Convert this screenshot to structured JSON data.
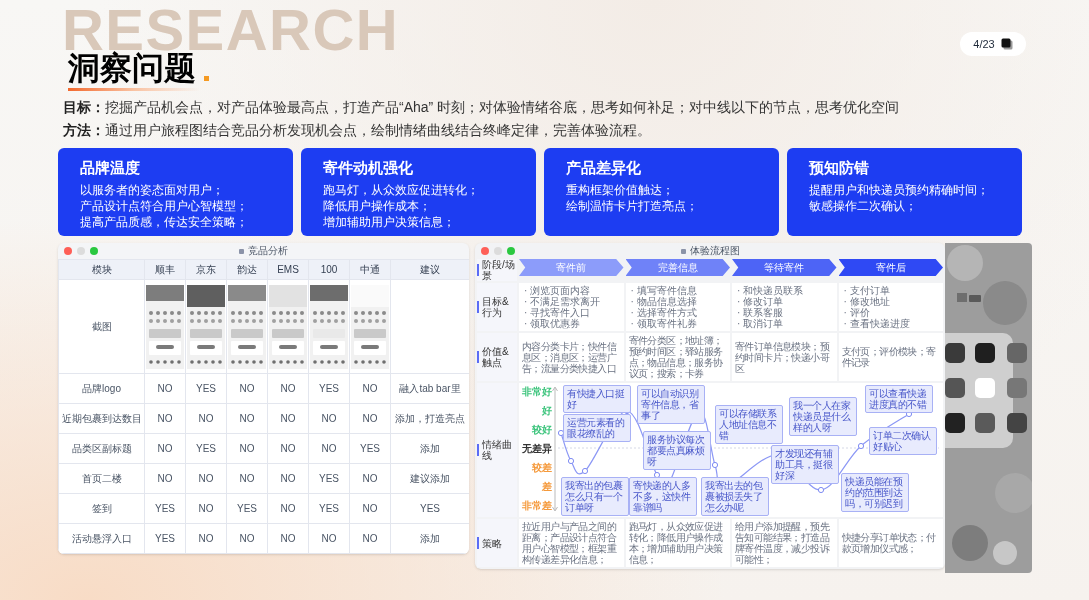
{
  "background_word": "RESEARCH",
  "title": "洞察问题",
  "page": "4/23",
  "intro": [
    {
      "label": "目标：",
      "text": "挖掘产品机会点，对产品体验最高点，打造产品“Aha” 时刻；对体验情绪谷底，思考如何补足；对中线以下的节点，思考优化空间"
    },
    {
      "label": "方法：",
      "text": "通过用户旅程图结合竞品分析发现机会点，绘制情绪曲线结合终峰定律，完善体验流程。"
    }
  ],
  "cards": [
    {
      "title": "品牌温度",
      "lines": [
        "以服务者的姿态面对用户；",
        "产品设计点符合用户心智模型；",
        "提高产品质感，传达安全策略；"
      ]
    },
    {
      "title": "寄件动机强化",
      "lines": [
        "跑马灯，从众效应促进转化；",
        "降低用户操作成本；",
        "增加辅助用户决策信息；"
      ]
    },
    {
      "title": "产品差异化",
      "lines": [
        "重构框架价值触达；",
        "绘制温情卡片打造亮点；"
      ]
    },
    {
      "title": "预知防错",
      "lines": [
        "提醒用户和快递员预约精确时间；",
        "敏感操作二次确认；"
      ]
    }
  ],
  "comparison_window": {
    "title": "竞品分析",
    "columns": [
      "模块",
      "顺丰",
      "京东",
      "韵达",
      "EMS",
      "100",
      "中通",
      "建议"
    ],
    "screenshot_row_label": "截图",
    "rows": [
      [
        "品牌logo",
        "NO",
        "YES",
        "NO",
        "NO",
        "YES",
        "NO",
        "融入tab bar里"
      ],
      [
        "近期包裹到达数目",
        "NO",
        "NO",
        "NO",
        "NO",
        "NO",
        "NO",
        "添加，打造亮点"
      ],
      [
        "品类区副标题",
        "NO",
        "YES",
        "NO",
        "NO",
        "NO",
        "YES",
        "添加"
      ],
      [
        "首页二楼",
        "NO",
        "NO",
        "NO",
        "NO",
        "YES",
        "NO",
        "建议添加"
      ],
      [
        "签到",
        "YES",
        "NO",
        "YES",
        "NO",
        "YES",
        "NO",
        "YES"
      ],
      [
        "活动悬浮入口",
        "YES",
        "NO",
        "NO",
        "NO",
        "NO",
        "NO",
        "添加"
      ]
    ]
  },
  "journey_window": {
    "title": "体验流程图",
    "row_labels": {
      "stage": "阶段/场景",
      "goals": "目标&行为",
      "touchpoints": "价值&触点",
      "curve": "情绪曲线",
      "strategy": "策略"
    },
    "stages": [
      {
        "name": "寄件前",
        "color": "#8c9cfa",
        "goals": [
          "· 浏览页面内容",
          "· 不满足需求离开",
          "· 寻找寄件入口",
          "· 领取优惠券"
        ],
        "touchpoints": "内容分类卡片；快件信息区；消息区；运营广告；流量分类快捷入口",
        "strategy": "拉近用户与产品之间的距离；产品设计点符合用户心智模型；框架重构传递差异化信息；"
      },
      {
        "name": "完善信息",
        "color": "#6f82f8",
        "goals": [
          "· 填写寄件信息",
          "· 物品信息选择",
          "· 选择寄件方式",
          "· 领取寄件礼券"
        ],
        "touchpoints": "寄件分类区；地址簿；预约时间区；驿站服务点；物品信息；服务协议页；搜索；卡券",
        "strategy": "跑马灯，从众效应促进转化；降低用户操作成本；增加辅助用户决策信息；"
      },
      {
        "name": "等待寄件",
        "color": "#4d64f6",
        "goals": [
          "· 和快递员联系",
          "· 修改订单",
          "· 联系客服",
          "· 取消订单"
        ],
        "touchpoints": "寄件订单信息模块；预约时间卡片；快递小哥区",
        "strategy": "给用户添加提醒，预先告知可能结果；打造品牌寄件温度，减少投诉可能性；"
      },
      {
        "name": "寄件后",
        "color": "#2f49f4",
        "goals": [
          "· 支付订单",
          "· 修改地址",
          "· 评价",
          "· 查看快递进度"
        ],
        "touchpoints": "支付页；评价模块；寄件记录",
        "strategy": "快捷分享订单状态；付款页增加仪式感；"
      }
    ],
    "levels": [
      {
        "label": "非常好",
        "color": "#3cc47c"
      },
      {
        "label": "好",
        "color": "#3cc47c"
      },
      {
        "label": "较好",
        "color": "#3cc47c"
      },
      {
        "label": "无差异",
        "color": "#333333"
      },
      {
        "label": "较差",
        "color": "#f59a3c"
      },
      {
        "label": "差",
        "color": "#f59a3c"
      },
      {
        "label": "非常差",
        "color": "#f59a3c"
      }
    ],
    "notes": [
      "有快捷入口挺好",
      "运营元素看的眼花缭乱的",
      "我寄出的包裹怎么只有一个订单呀",
      "可以自动识别寄件信息，省事了",
      "服务协议每次都要点真麻烦呀",
      "寄快递的人多不多，这快件靠谱吗",
      "可以存储联系人地址信息不错",
      "我寄出去的包裹被损丢失了怎么办呢",
      "我一个人在家快递员是什么样的人呀",
      "才发现还有辅助工具，挺很好深",
      "可以查看快递进度真的不错",
      "订单二次确认好贴心",
      "快递员能在预约的范围到达吗，可别迟到"
    ]
  }
}
